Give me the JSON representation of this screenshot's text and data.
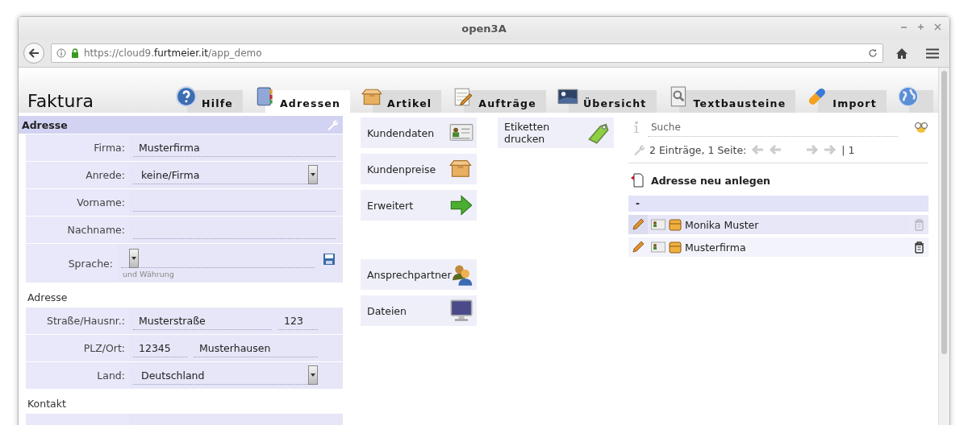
{
  "window": {
    "title": "open3A"
  },
  "browser": {
    "url_prefix": "https://cloud9.",
    "url_domain": "furtmeier.it",
    "url_path": "/app_demo"
  },
  "app": {
    "title": "Faktura"
  },
  "tabs": [
    {
      "label": "Hilfe",
      "kind": "help",
      "selected": false
    },
    {
      "label": "Adressen",
      "kind": "book",
      "selected": true
    },
    {
      "label": "Artikel",
      "kind": "box",
      "selected": false
    },
    {
      "label": "Aufträge",
      "kind": "notepad",
      "selected": false
    },
    {
      "label": "Übersicht",
      "kind": "photo",
      "selected": false
    },
    {
      "label": "Textbausteine",
      "kind": "document",
      "selected": false
    },
    {
      "label": "Import",
      "kind": "pill",
      "selected": false
    },
    {
      "kind": "globe",
      "selected": false
    }
  ],
  "form": {
    "title": "Adresse",
    "rows": [
      {
        "kind": "text",
        "label": "Firma:",
        "value": "Musterfirma"
      },
      {
        "kind": "select",
        "label": "Anrede:",
        "value": "keine/Firma"
      },
      {
        "kind": "text",
        "label": "Vorname:"
      },
      {
        "kind": "text",
        "label": "Nachname:"
      },
      {
        "kind": "select_save",
        "label": "Sprache:",
        "hint": "und Währung"
      },
      {
        "kind": "heading",
        "label": "Adresse"
      },
      {
        "kind": "wide_narrow",
        "label": "Straße/Hausnr.:",
        "value": "Musterstraße",
        "value_2": "123"
      },
      {
        "kind": "narrow_wide",
        "label": "PLZ/Ort:",
        "value": "12345",
        "value_2": "Musterhausen"
      },
      {
        "kind": "select",
        "label": "Land:",
        "value": "Deutschland"
      },
      {
        "kind": "heading",
        "label": "Kontakt"
      },
      {
        "kind": "text"
      }
    ]
  },
  "action_groups": [
    [
      {
        "label": "Kundendaten",
        "kind": "card"
      },
      {
        "label": "Kundenpreise",
        "kind": "box"
      },
      {
        "label": "Erweitert",
        "kind": "arrow"
      }
    ],
    [
      {
        "label": "Ansprechpartner",
        "kind": "people"
      },
      {
        "label": "Dateien",
        "kind": "monitor"
      }
    ]
  ],
  "label_action": {
    "label": "Etiketten drucken",
    "kind": "tag"
  },
  "search": {
    "placeholder": "Suche"
  },
  "paging": {
    "summary": "2 Einträge, 1 Seite:",
    "pages": "| 1"
  },
  "new_button": {
    "label": "Adresse neu anlegen"
  },
  "list": {
    "group": "-",
    "rows": [
      {
        "name": "Monika Muster",
        "selected": true
      },
      {
        "name": "Musterfirma",
        "selected": false
      }
    ]
  }
}
